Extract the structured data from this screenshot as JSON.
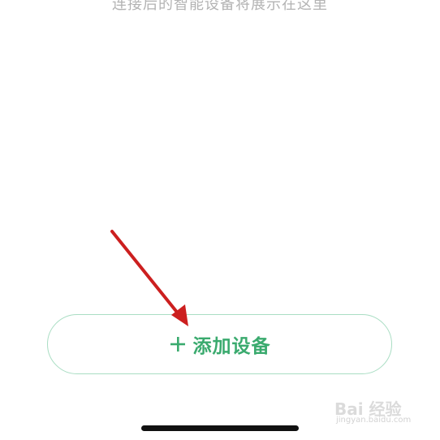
{
  "empty_state": {
    "hint_text": "连接后的智能设备将展示在这里"
  },
  "add_device_button": {
    "icon": "plus-icon",
    "label": "添加设备",
    "accent_color": "#3aaa6e",
    "border_color": "#a9ddc3"
  },
  "annotation": {
    "icon": "red-arrow-icon",
    "color": "#cc1f1f"
  },
  "watermark": {
    "main": "Bai 经验",
    "sub": "jingyan.baidu.com"
  }
}
